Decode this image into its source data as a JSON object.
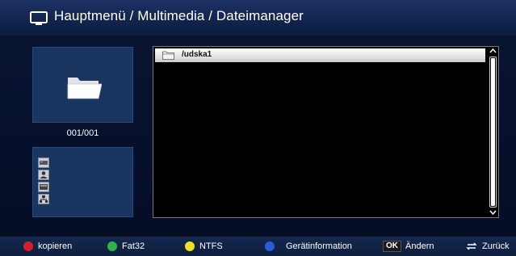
{
  "header": {
    "title": "Hauptmenü / Multimedia / Dateimanager",
    "icon": "tv-icon"
  },
  "preview": {
    "icon": "folder-icon",
    "counter": "001/001"
  },
  "devices": {
    "icons": [
      "drive-icon",
      "user-icon",
      "disk-icon",
      "network-icon"
    ]
  },
  "file_list": {
    "items": [
      {
        "label": "/udska1",
        "icon": "folder-icon",
        "selected": true
      }
    ]
  },
  "footer": {
    "red": {
      "label": "kopieren",
      "color": "#d81e2a"
    },
    "green": {
      "label": "Fat32",
      "color": "#2db34a"
    },
    "yellow": {
      "label": "NTFS",
      "color": "#f2e01e"
    },
    "blue": {
      "label": "Gerätinformation",
      "color": "#2a5bd8"
    },
    "ok": {
      "key": "OK",
      "label": "Ändern"
    },
    "back": {
      "label": "Zurück"
    }
  }
}
